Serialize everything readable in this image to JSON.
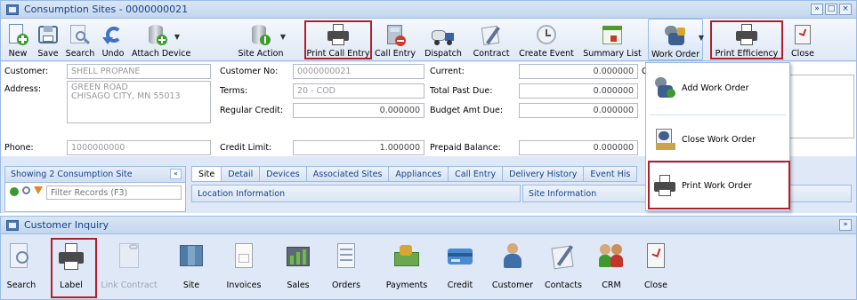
{
  "colors": {
    "accent_border": "#99bbe8",
    "highlight_red": "#b41e2a",
    "panel_bg": "#dfe8f6",
    "title_text": "#15428b"
  },
  "window1": {
    "title": "Consumption Sites - 0000000021",
    "controls": [
      "»",
      "□",
      "×"
    ],
    "toolbar": [
      {
        "label": "New",
        "icon": "new-document-icon"
      },
      {
        "label": "Save",
        "icon": "save-icon"
      },
      {
        "label": "Search",
        "icon": "search-icon"
      },
      {
        "label": "Undo",
        "icon": "undo-icon"
      },
      {
        "label": "Attach Device",
        "icon": "attach-device-icon"
      },
      {
        "label": "Site Action",
        "icon": "site-action-icon"
      },
      {
        "label": "Print Call Entry",
        "icon": "printer-icon"
      },
      {
        "label": "Call Entry",
        "icon": "call-entry-icon"
      },
      {
        "label": "Dispatch",
        "icon": "truck-icon"
      },
      {
        "label": "Contract",
        "icon": "contract-icon"
      },
      {
        "label": "Create Event",
        "icon": "clock-icon"
      },
      {
        "label": "Summary List",
        "icon": "summary-list-icon"
      },
      {
        "label": "Work Order",
        "icon": "work-order-icon"
      },
      {
        "label": "Print Efficiency",
        "icon": "printer-icon"
      },
      {
        "label": "Close",
        "icon": "close-icon"
      }
    ],
    "form": {
      "customer_label": "Customer:",
      "customer_value": "SHELL PROPANE",
      "address_label": "Address:",
      "address_line1": "GREEN ROAD",
      "address_line2": "CHISAGO CITY, MN 55013",
      "phone_label": "Phone:",
      "phone_value": "1000000000",
      "customer_no_label": "Customer No:",
      "customer_no_value": "0000000021",
      "terms_label": "Terms:",
      "terms_value": "20 - COD",
      "regular_credit_label": "Regular Credit:",
      "regular_credit_value": "0.000000",
      "credit_limit_label": "Credit Limit:",
      "credit_limit_value": "1.000000",
      "current_label": "Current:",
      "current_value": "0.000000",
      "total_past_due_label": "Total Past Due:",
      "total_past_due_value": "0.000000",
      "budget_amt_due_label": "Budget Amt Due:",
      "budget_amt_due_value": "0.000000",
      "prepaid_balance_label": "Prepaid Balance:",
      "prepaid_balance_value": "0.000000",
      "partial_c": "C"
    },
    "sites_panel": {
      "header": "Showing 2 Consumption Site",
      "collapse": "«",
      "filter_placeholder": "Filter Records (F3)"
    },
    "tabs": [
      "Site",
      "Detail",
      "Devices",
      "Associated Sites",
      "Appliances",
      "Call Entry",
      "Delivery History",
      "Event His"
    ],
    "location_information": "Location Information",
    "site_information": "Site Information",
    "work_order_menu": [
      {
        "label": "Add Work Order",
        "icon": "add-work-order-icon"
      },
      {
        "label": "Close Work Order",
        "icon": "close-work-order-icon"
      },
      {
        "label": "Print Work Order",
        "icon": "printer-icon"
      }
    ]
  },
  "window2": {
    "title": "Customer Inquiry",
    "controls": [
      "»"
    ],
    "toolbar": [
      {
        "label": "Search",
        "icon": "search-icon"
      },
      {
        "label": "Label",
        "icon": "printer-icon"
      },
      {
        "label": "Link Contract",
        "icon": "link-contract-icon",
        "disabled": true
      },
      {
        "label": "Site",
        "icon": "map-icon"
      },
      {
        "label": "Invoices",
        "icon": "invoice-icon"
      },
      {
        "label": "Sales",
        "icon": "sales-chart-icon"
      },
      {
        "label": "Orders",
        "icon": "orders-icon"
      },
      {
        "label": "Payments",
        "icon": "payments-icon"
      },
      {
        "label": "Credit",
        "icon": "credit-card-icon"
      },
      {
        "label": "Customer",
        "icon": "customer-icon"
      },
      {
        "label": "Contacts",
        "icon": "contacts-icon"
      },
      {
        "label": "CRM",
        "icon": "crm-icon"
      },
      {
        "label": "Close",
        "icon": "close-icon"
      }
    ]
  }
}
